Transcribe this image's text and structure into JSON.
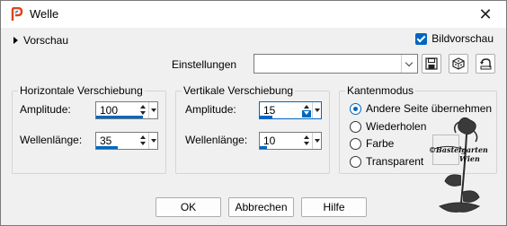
{
  "window": {
    "title": "Welle",
    "close_glyph": "✕"
  },
  "header": {
    "preview_label": "Vorschau",
    "image_preview_label": "Bildvorschau",
    "image_preview_checked": true
  },
  "settings": {
    "label": "Einstellungen",
    "value": ""
  },
  "horizontal": {
    "legend": "Horizontale Verschiebung",
    "amplitude_label": "Amplitude:",
    "amplitude_value": "100",
    "wavelength_label": "Wellenlänge:",
    "wavelength_value": "35"
  },
  "vertical": {
    "legend": "Vertikale Verschiebung",
    "amplitude_label": "Amplitude:",
    "amplitude_value": "15",
    "wavelength_label": "Wellenlänge:",
    "wavelength_value": "10"
  },
  "edge_mode": {
    "legend": "Kantenmodus",
    "options": [
      "Andere Seite übernehmen",
      "Wiederholen",
      "Farbe",
      "Transparent"
    ],
    "selected": "Andere Seite übernehmen"
  },
  "watermark": {
    "line1": "©Bastelgarten",
    "line2": "Wien"
  },
  "buttons": {
    "ok": "OK",
    "cancel": "Abbrechen",
    "help": "Hilfe"
  },
  "colors": {
    "accent": "#0067c0",
    "app_icon_red": "#e0401c"
  }
}
